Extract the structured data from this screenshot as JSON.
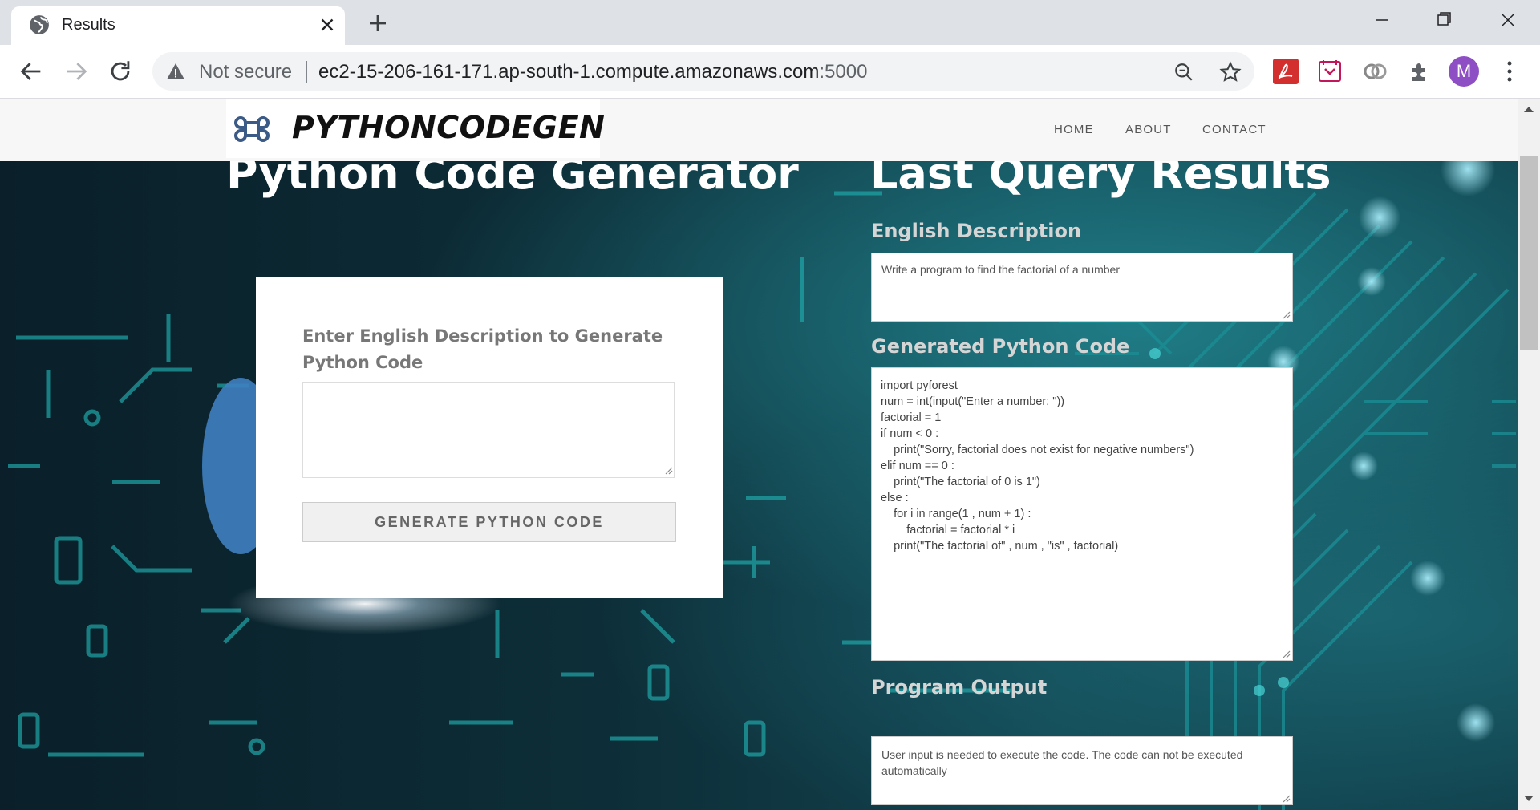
{
  "browser": {
    "tab_title": "Results",
    "security_label": "Not secure",
    "url_host": "ec2-15-206-161-171.ap-south-1.compute.amazonaws.com",
    "url_port": ":5000",
    "profile_initial": "M"
  },
  "site": {
    "brand": "PYTHONCODEGEN",
    "nav": [
      "HOME",
      "ABOUT",
      "CONTACT"
    ]
  },
  "generator": {
    "title": "Python Code Generator",
    "label": "Enter English Description to Generate Python Code",
    "input_value": "",
    "button_label": "GENERATE PYTHON CODE"
  },
  "results": {
    "title": "Last Query Results",
    "description_label": "English Description",
    "description_value": "Write a program to find the factorial of a number",
    "code_label": "Generated Python Code",
    "code_value": "import pyforest\nnum = int(input(\"Enter a number: \"))\nfactorial = 1\nif num < 0 :\n    print(\"Sorry, factorial does not exist for negative numbers\")\nelif num == 0 :\n    print(\"The factorial of 0 is 1\")\nelse :\n    for i in range(1 , num + 1) :\n        factorial = factorial * i\n    print(\"The factorial of\" , num , \"is\" , factorial)",
    "output_label": "Program Output",
    "output_value": "User input is needed to execute the code. The code can not be executed automatically"
  },
  "icons": {
    "tab_favicon": "globe-icon",
    "logo": "command-key-icon"
  },
  "colors": {
    "profile": "#8e4fc4",
    "pdf_extension": "#d32f2f",
    "hero_background": "#0d2e38",
    "circuit_lines": "#1fa6a8"
  }
}
